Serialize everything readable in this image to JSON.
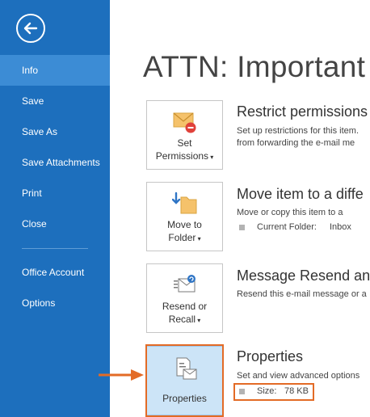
{
  "sidebar": {
    "back_icon": "back-arrow-icon",
    "items": [
      {
        "label": "Info",
        "active": true
      },
      {
        "label": "Save"
      },
      {
        "label": "Save As"
      },
      {
        "label": "Save Attachments"
      },
      {
        "label": "Print"
      },
      {
        "label": "Close"
      },
      {
        "label": "Office Account"
      },
      {
        "label": "Options"
      }
    ]
  },
  "main": {
    "title": "ATTN: Important",
    "sections": [
      {
        "tile_label_line1": "Set",
        "tile_label_line2": "Permissions",
        "tile_icon": "envelope-restricted-icon",
        "title": "Restrict permissions",
        "desc_line1": "Set up restrictions for this item.",
        "desc_line2": "from forwarding the e-mail me"
      },
      {
        "tile_label_line1": "Move to",
        "tile_label_line2": "Folder",
        "tile_icon": "move-to-folder-icon",
        "title": "Move item to a diffe",
        "desc_line1": "Move or copy this item to a",
        "detail_label": "Current Folder:",
        "detail_value": "Inbox"
      },
      {
        "tile_label_line1": "Resend or",
        "tile_label_line2": "Recall",
        "tile_icon": "resend-recall-icon",
        "title": "Message Resend and",
        "desc_line1": "Resend this e-mail message or a"
      },
      {
        "tile_label_line1": "Properties",
        "tile_icon": "properties-icon",
        "title": "Properties",
        "desc_line1": "Set and view advanced options",
        "detail_label": "Size:",
        "detail_value": "78 KB"
      }
    ]
  },
  "colors": {
    "sidebar": "#1d6fbd",
    "sidebar_active": "#3c8cd5",
    "highlight": "#e36b26",
    "selected_tile": "#cce4f7"
  }
}
